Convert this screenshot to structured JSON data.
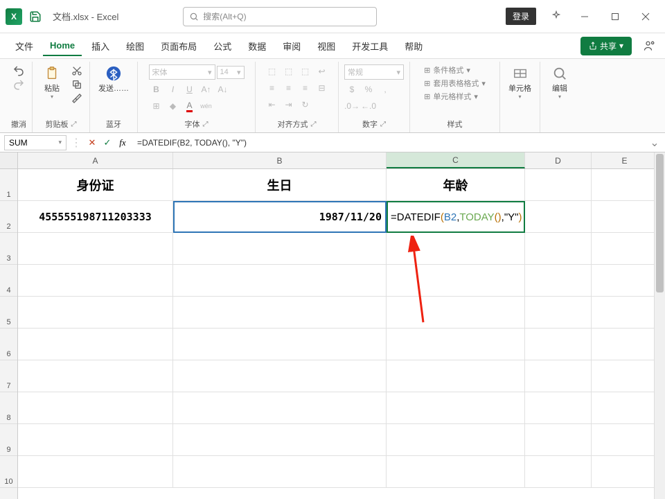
{
  "title": {
    "doc": "文档.xlsx",
    "sep": " - ",
    "app": "Excel"
  },
  "search": {
    "placeholder": "搜索(Alt+Q)"
  },
  "login": "登录",
  "tabs": {
    "file": "文件",
    "home": "Home",
    "insert": "插入",
    "draw": "绘图",
    "layout": "页面布局",
    "formulas": "公式",
    "data": "数据",
    "review": "审阅",
    "view": "视图",
    "devtools": "开发工具",
    "help": "帮助"
  },
  "share": "共享",
  "ribbon": {
    "undo": "撤消",
    "clipboard": {
      "label": "剪贴板",
      "paste": "粘贴"
    },
    "bluetooth": {
      "label": "蓝牙",
      "send": "发送……"
    },
    "font": {
      "label": "字体",
      "name": "宋体",
      "size": "14"
    },
    "align": {
      "label": "对齐方式"
    },
    "number": {
      "label": "数字",
      "format": "常规"
    },
    "styles": {
      "label": "样式",
      "cond": "条件格式",
      "table": "套用表格格式",
      "cell": "单元格样式"
    },
    "cells": {
      "label": "单元格"
    },
    "editing": {
      "label": "编辑"
    }
  },
  "namebox": "SUM",
  "formula": "=DATEDIF(B2, TODAY(), \"Y\")",
  "formula_tokens": {
    "eq": "=",
    "fn": "DATEDIF",
    "lp": "(",
    "ref": "B2",
    "c1": ", ",
    "today": "TODAY",
    "lp2": "(",
    "rp2": ")",
    "c2": ", ",
    "str": "\"Y\"",
    "rp": ")"
  },
  "columns": [
    "A",
    "B",
    "C",
    "D",
    "E"
  ],
  "headers": {
    "A": "身份证",
    "B": "生日",
    "C": "年龄"
  },
  "row2": {
    "A": "455555198711203333",
    "B": "1987/11/20"
  },
  "rownums": [
    "1",
    "2",
    "3",
    "4",
    "5",
    "6",
    "7",
    "8",
    "9",
    "10"
  ]
}
